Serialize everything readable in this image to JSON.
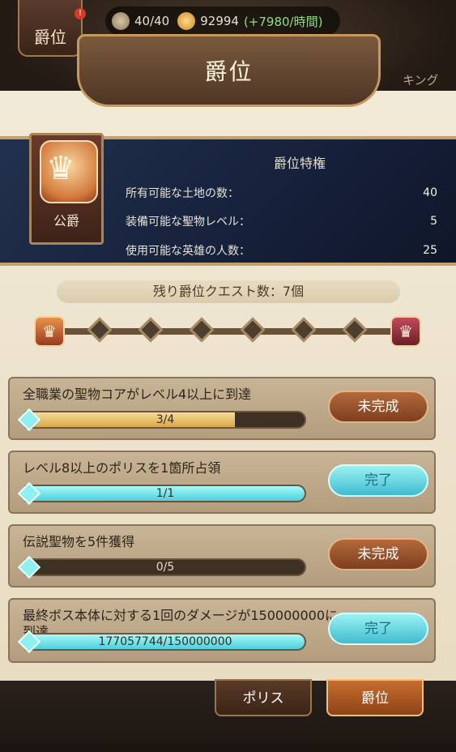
{
  "top": {
    "badge_label": "爵位",
    "badge_dot": "!",
    "resources": [
      {
        "icon": "stamina-icon",
        "value": "40/40"
      },
      {
        "icon": "gold-icon",
        "value": "92994",
        "rate": "(+7980/時間)"
      }
    ],
    "right_label": "キング"
  },
  "header": {
    "title": "爵位"
  },
  "privilege": {
    "rank_label": "公爵",
    "section_title": "爵位特権",
    "rows": [
      {
        "label": "所有可能な土地の数：",
        "value": "40"
      },
      {
        "label": "装備可能な聖物レベル：",
        "value": "5"
      },
      {
        "label": "使用可能な英雄の人数：",
        "value": "25"
      }
    ]
  },
  "quest_counter": "残り爵位クエスト数：7個",
  "quests": [
    {
      "text": "全職業の聖物コアがレベル4以上に到達",
      "progress_text": "3/4",
      "progress": 0.75,
      "status": "未完成",
      "done": false
    },
    {
      "text": "レベル8以上のポリスを1箇所占領",
      "progress_text": "1/1",
      "progress": 1.0,
      "status": "完了",
      "done": true
    },
    {
      "text": "伝説聖物を5件獲得",
      "progress_text": "0/5",
      "progress": 0.0,
      "status": "未完成",
      "done": false
    },
    {
      "text": "最終ボス本体に対する1回のダメージが150000000に到達",
      "progress_text": "177057744/150000000",
      "progress": 1.0,
      "status": "完了",
      "done": true
    }
  ],
  "tabs": [
    {
      "label": "ポリス",
      "active": false
    },
    {
      "label": "爵位",
      "active": true
    }
  ],
  "colors": {
    "accent_gold": "#c6a06a",
    "incomplete": "#7e3e20",
    "done": "#41bccf"
  }
}
